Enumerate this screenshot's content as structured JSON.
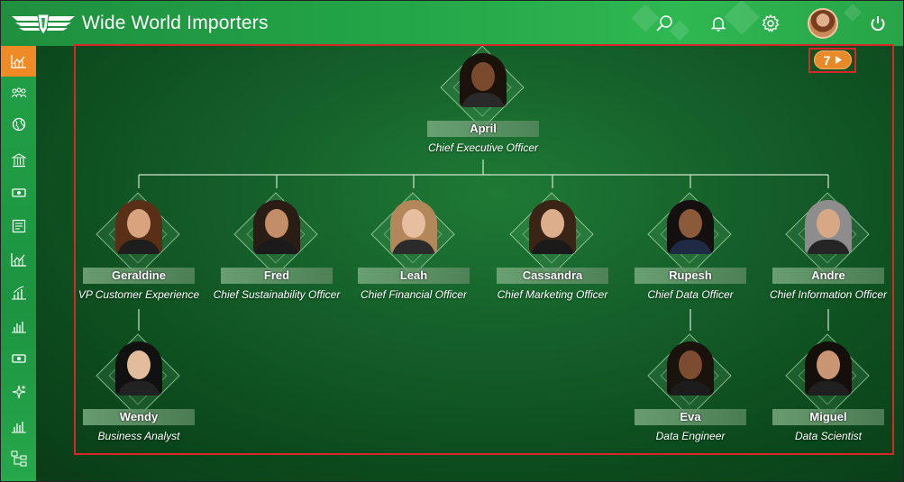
{
  "header": {
    "app_title": "Wide World Importers",
    "icons": [
      "search-icon",
      "bell-icon",
      "gear-icon",
      "power-icon"
    ]
  },
  "sidebar": {
    "items": [
      {
        "icon": "line-chart-icon",
        "active": true
      },
      {
        "icon": "people-icon",
        "active": false
      },
      {
        "icon": "globe-icon",
        "active": false
      },
      {
        "icon": "bank-icon",
        "active": false
      },
      {
        "icon": "money-icon",
        "active": false
      },
      {
        "icon": "report-icon",
        "active": false
      },
      {
        "icon": "line-chart-icon",
        "active": false
      },
      {
        "icon": "bar-growth-icon",
        "active": false
      },
      {
        "icon": "bar-chart-icon",
        "active": false
      },
      {
        "icon": "money-icon",
        "active": false
      },
      {
        "icon": "sparkles-icon",
        "active": false
      },
      {
        "icon": "bar-chart-icon",
        "active": false
      },
      {
        "icon": "org-chart-icon",
        "active": false
      }
    ]
  },
  "counter": {
    "value": "7"
  },
  "org": {
    "ceo": {
      "name": "April",
      "role": "Chief Executive Officer"
    },
    "level2": [
      {
        "name": "Geraldine",
        "role": "VP Customer Experience"
      },
      {
        "name": "Fred",
        "role": "Chief Sustainability Officer"
      },
      {
        "name": "Leah",
        "role": "Chief Financial Officer"
      },
      {
        "name": "Cassandra",
        "role": "Chief Marketing Officer"
      },
      {
        "name": "Rupesh",
        "role": "Chief Data Officer"
      },
      {
        "name": "Andre",
        "role": "Chief Information Officer"
      }
    ],
    "level3": [
      {
        "name": "Wendy",
        "role": "Business Analyst"
      },
      {
        "name": "Eva",
        "role": "Data Engineer"
      },
      {
        "name": "Miguel",
        "role": "Data Scientist"
      }
    ]
  },
  "colors": {
    "accent": "#f08a24",
    "header_green": "#23a648",
    "highlight_border": "#d9262a"
  }
}
